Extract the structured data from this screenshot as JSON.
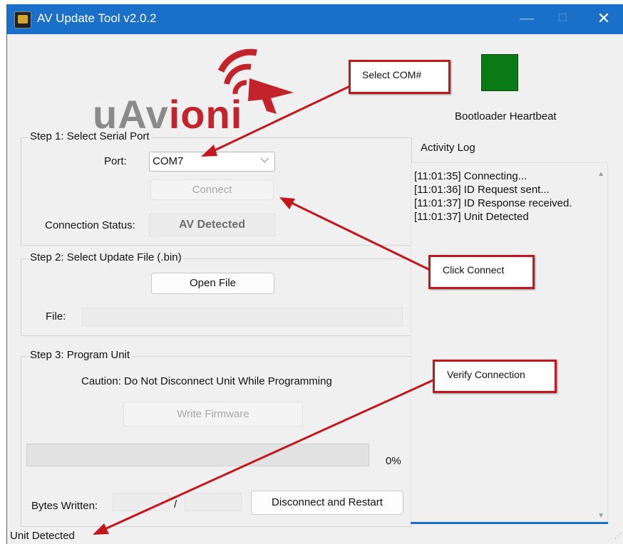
{
  "window": {
    "title": "AV Update Tool v2.0.2",
    "controls": {
      "minimize": "—",
      "maximize": "☐",
      "close": "✕"
    }
  },
  "logo": {
    "part1": "uAv",
    "part2": "ioni"
  },
  "heartbeat": {
    "label": "Bootloader Heartbeat",
    "color": "#0a7a14"
  },
  "step1": {
    "title": "Step 1: Select Serial Port",
    "port_label": "Port:",
    "port_value": "COM7",
    "connect_label": "Connect",
    "status_label": "Connection Status:",
    "status_value": "AV Detected"
  },
  "step2": {
    "title": "Step 2: Select Update File (.bin)",
    "open_label": "Open File",
    "file_label": "File:"
  },
  "step3": {
    "title": "Step 3: Program Unit",
    "caution": "Caution: Do Not Disconnect Unit While Programming",
    "write_label": "Write Firmware",
    "progress": 0,
    "progress_text": "0%",
    "bytes_label": "Bytes Written:",
    "separator": "/",
    "disconnect_label": "Disconnect and Restart"
  },
  "activity_log": {
    "title": "Activity Log",
    "lines": [
      "[11:01:35] Connecting...",
      "[11:01:36] ID Request sent...",
      "[11:01:37] ID Response received.",
      "[11:01:37] Unit Detected"
    ]
  },
  "statusbar": {
    "text": "Unit Detected"
  },
  "callouts": {
    "select_com": "Select COM#",
    "click_connect": "Click Connect",
    "verify_connection": "Verify Connection"
  },
  "colors": {
    "titlebar": "#1a6fc9",
    "accent_red": "#c4171d",
    "heartbeat": "#0a7a14"
  }
}
